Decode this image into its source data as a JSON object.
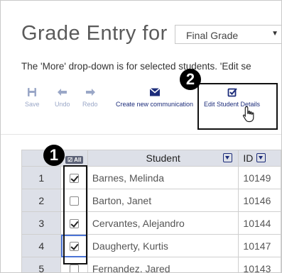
{
  "header": {
    "title": "Grade Entry for",
    "grade_select": {
      "value": "Final Grade",
      "caret": "▼"
    }
  },
  "info_text": "The 'More' drop-down is for selected students. 'Edit se",
  "toolbar": {
    "save": "Save",
    "undo": "Undo",
    "redo": "Redo",
    "create_communication": "Create new communication",
    "edit_student_details": "Edit Student Details"
  },
  "callouts": {
    "one": "1",
    "two": "2"
  },
  "table": {
    "all_chip": "All",
    "headers": {
      "student": "Student",
      "id": "ID"
    },
    "rows": [
      {
        "num": "1",
        "checked": true,
        "name": "Barnes, Melinda",
        "id": "10149"
      },
      {
        "num": "2",
        "checked": false,
        "name": "Barton, Janet",
        "id": "10146"
      },
      {
        "num": "3",
        "checked": true,
        "name": "Cervantes, Alejandro",
        "id": "10144"
      },
      {
        "num": "4",
        "checked": true,
        "name": "Daugherty, Kurtis",
        "id": "10147"
      },
      {
        "num": "5",
        "checked": false,
        "name": "Fernandez, Jared",
        "id": "10143"
      }
    ]
  },
  "colors": {
    "accent": "#1c2c7a",
    "toolbar_muted": "#9aa7c7",
    "header_bg": "#dde0e8"
  }
}
